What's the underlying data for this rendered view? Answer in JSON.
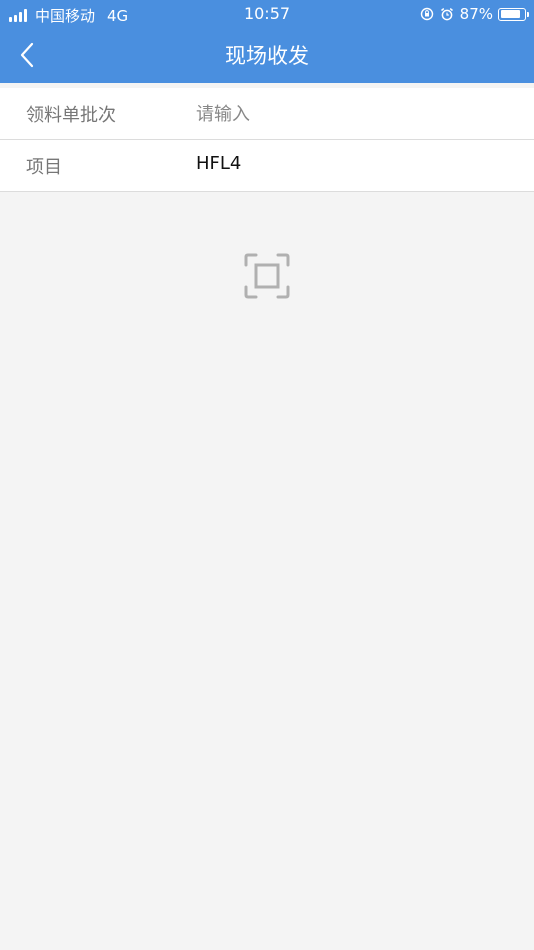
{
  "status_bar": {
    "carrier": "中国移动",
    "network": "4G",
    "time": "10:57",
    "battery_percent": "87%",
    "battery_level": 0.87,
    "icons": [
      "signal-icon",
      "orientation-lock-icon",
      "alarm-icon",
      "battery-icon"
    ]
  },
  "header": {
    "title": "现场收发",
    "back_icon": "chevron-left-icon",
    "background_color": "#4a8fdf"
  },
  "form": {
    "batch": {
      "label": "领料单批次",
      "placeholder": "请输入",
      "value": ""
    },
    "project": {
      "label": "项目",
      "value": "HFL4"
    }
  },
  "scan": {
    "icon": "scan-icon"
  }
}
